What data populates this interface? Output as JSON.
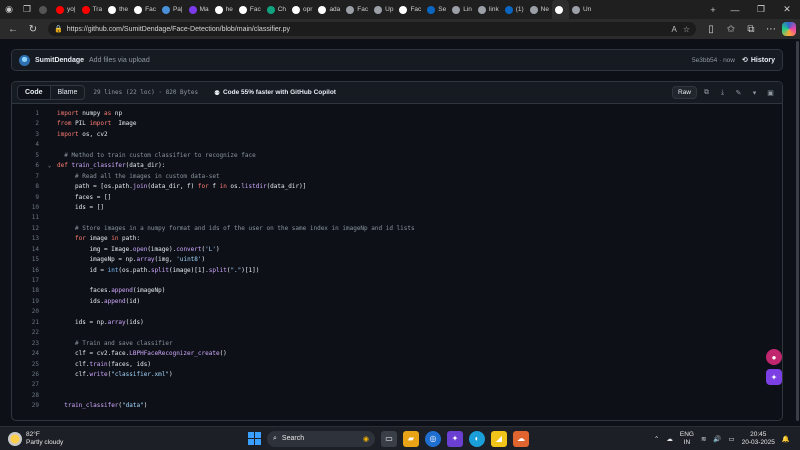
{
  "browser": {
    "tabs": [
      {
        "label": "",
        "icon": "gear-icon",
        "color": "#555555"
      },
      {
        "label": "yo|",
        "icon": "youtube-icon",
        "color": "#ff0000"
      },
      {
        "label": "Tra",
        "icon": "youtube-icon",
        "color": "#ff0000"
      },
      {
        "label": "the",
        "icon": "github-icon",
        "color": "#ffffff"
      },
      {
        "label": "Fac",
        "icon": "github-icon",
        "color": "#ffffff"
      },
      {
        "label": "Pa|",
        "icon": "doc-icon",
        "color": "#4a90d9"
      },
      {
        "label": "Ma",
        "icon": "doc-icon",
        "color": "#7c3aed"
      },
      {
        "label": "he",
        "icon": "github-icon",
        "color": "#ffffff"
      },
      {
        "label": "Fac",
        "icon": "github-icon",
        "color": "#ffffff"
      },
      {
        "label": "Ch",
        "icon": "chatgpt-icon",
        "color": "#10a37f"
      },
      {
        "label": "opr",
        "icon": "github-icon",
        "color": "#ffffff"
      },
      {
        "label": "ada",
        "icon": "github-icon",
        "color": "#ffffff"
      },
      {
        "label": "Fac",
        "icon": "doc-icon",
        "color": "#9aa0a6"
      },
      {
        "label": "Up",
        "icon": "doc-icon",
        "color": "#9aa0a6"
      },
      {
        "label": "Fac",
        "icon": "github-icon",
        "color": "#ffffff"
      },
      {
        "label": "Se",
        "icon": "linkedin-icon",
        "color": "#0a66c2"
      },
      {
        "label": "Lin",
        "icon": "doc-icon",
        "color": "#9aa0a6"
      },
      {
        "label": "link",
        "icon": "search-icon",
        "color": "#9aa0a6"
      },
      {
        "label": "(1)",
        "icon": "linkedin-icon",
        "color": "#0a66c2"
      },
      {
        "label": "Ne",
        "icon": "doc-icon",
        "color": "#9aa0a6"
      },
      {
        "label": "",
        "icon": "github-icon",
        "color": "#ffffff",
        "active": true
      },
      {
        "label": "Un",
        "icon": "new-tab-icon",
        "color": "#9aa0a6"
      }
    ],
    "new_tab": "+",
    "url": "https://github.com/SumitDendage/Face-Detection/blob/main/classifier.py"
  },
  "commit": {
    "user": "SumitDendage",
    "message": "Add files via upload",
    "hash_time": "5e3bb54 · now",
    "history": "History"
  },
  "file_header": {
    "code_tab": "Code",
    "blame_tab": "Blame",
    "info": "29 lines (22 loc) · 820 Bytes",
    "copilot": "Code 55% faster with GitHub Copilot",
    "raw": "Raw"
  },
  "code_lines": [
    [
      [
        "kw",
        "import"
      ],
      [
        "src",
        " numpy "
      ],
      [
        "kw",
        "as"
      ],
      [
        "src",
        " np"
      ]
    ],
    [
      [
        "kw",
        "from"
      ],
      [
        "src",
        " PIL "
      ],
      [
        "kw",
        "import"
      ],
      [
        "src",
        "  Image"
      ]
    ],
    [
      [
        "kw",
        "import"
      ],
      [
        "src",
        " os, cv2"
      ]
    ],
    [],
    [
      [
        "cm",
        "  # Method to train custom classifier to recognize face"
      ]
    ],
    [
      [
        "kw",
        "def"
      ],
      [
        "src",
        " "
      ],
      [
        "fn",
        "train_classifer"
      ],
      [
        "src",
        "(data_dir):"
      ]
    ],
    [
      [
        "cm",
        "     # Read all the images in custom data-set"
      ]
    ],
    [
      [
        "src",
        "     path = [os.path."
      ],
      [
        "fn",
        "join"
      ],
      [
        "src",
        "(data_dir, f) "
      ],
      [
        "kw",
        "for"
      ],
      [
        "src",
        " f "
      ],
      [
        "kw",
        "in"
      ],
      [
        "src",
        " os."
      ],
      [
        "fn",
        "listdir"
      ],
      [
        "src",
        "(data_dir)]"
      ]
    ],
    [
      [
        "src",
        "     faces = []"
      ]
    ],
    [
      [
        "src",
        "     ids = []"
      ]
    ],
    [],
    [
      [
        "cm",
        "     # Store images in a numpy format and ids of the user on the same index in imageNp and id lists"
      ]
    ],
    [
      [
        "kw",
        "     for"
      ],
      [
        "src",
        " image "
      ],
      [
        "kw",
        "in"
      ],
      [
        "src",
        " path:"
      ]
    ],
    [
      [
        "src",
        "         img = Image."
      ],
      [
        "fn",
        "open"
      ],
      [
        "src",
        "(image)."
      ],
      [
        "fn",
        "convert"
      ],
      [
        "src",
        "("
      ],
      [
        "str",
        "'L'"
      ],
      [
        "src",
        ")"
      ]
    ],
    [
      [
        "src",
        "         imageNp = np."
      ],
      [
        "fn",
        "array"
      ],
      [
        "src",
        "(img, "
      ],
      [
        "str",
        "'uint8'"
      ],
      [
        "src",
        ")"
      ]
    ],
    [
      [
        "src",
        "         id = "
      ],
      [
        "bi",
        "int"
      ],
      [
        "src",
        "(os.path."
      ],
      [
        "fn",
        "split"
      ],
      [
        "src",
        "(image)[1]."
      ],
      [
        "fn",
        "split"
      ],
      [
        "src",
        "("
      ],
      [
        "str",
        "\".\""
      ],
      [
        "src",
        ")[1])"
      ]
    ],
    [],
    [
      [
        "src",
        "         faces."
      ],
      [
        "fn",
        "append"
      ],
      [
        "src",
        "(imageNp)"
      ]
    ],
    [
      [
        "src",
        "         ids."
      ],
      [
        "fn",
        "append"
      ],
      [
        "src",
        "(id)"
      ]
    ],
    [],
    [
      [
        "src",
        "     ids = np."
      ],
      [
        "fn",
        "array"
      ],
      [
        "src",
        "(ids)"
      ]
    ],
    [],
    [
      [
        "cm",
        "     # Train and save classifier"
      ]
    ],
    [
      [
        "src",
        "     clf = cv2.face."
      ],
      [
        "fn",
        "LBPHFaceRecognizer_create"
      ],
      [
        "src",
        "()"
      ]
    ],
    [
      [
        "src",
        "     clf."
      ],
      [
        "fn",
        "train"
      ],
      [
        "src",
        "(faces, ids)"
      ]
    ],
    [
      [
        "src",
        "     clf."
      ],
      [
        "fn",
        "write"
      ],
      [
        "src",
        "("
      ],
      [
        "str",
        "\"classifier.xml\""
      ],
      [
        "src",
        ")"
      ]
    ],
    [],
    [],
    [
      [
        "src",
        "  "
      ],
      [
        "fn",
        "train_classifer"
      ],
      [
        "src",
        "("
      ],
      [
        "str",
        "\"data\""
      ],
      [
        "src",
        ")"
      ]
    ]
  ],
  "taskbar": {
    "temp": "82°F",
    "weather": "Partly cloudy",
    "search": "Search",
    "lang_top": "ENG",
    "lang_bottom": "IN",
    "time": "20:45",
    "date": "20-03-2025"
  }
}
